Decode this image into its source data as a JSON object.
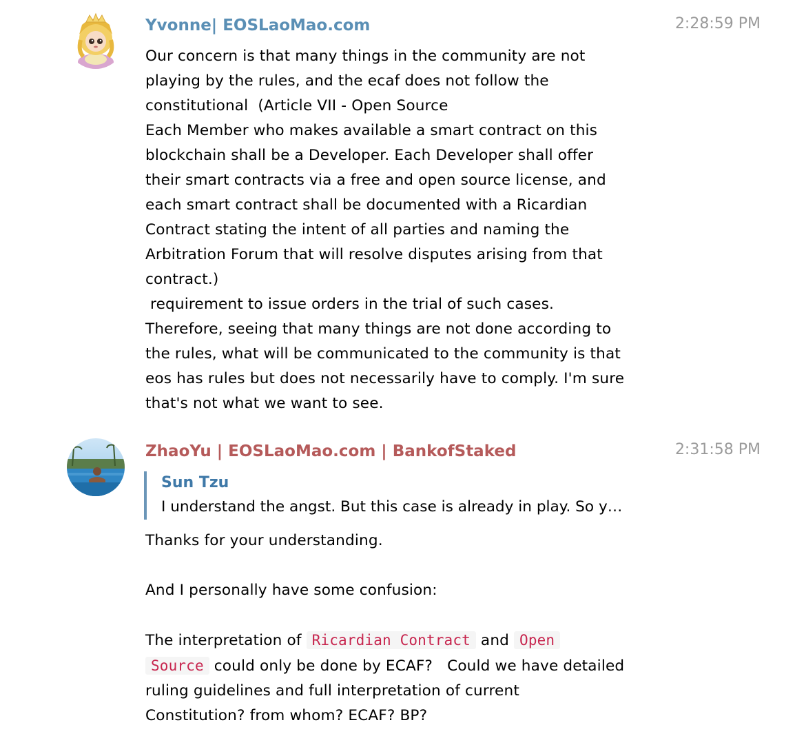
{
  "messages": [
    {
      "sender": "Yvonne| EOSLaoMao.com",
      "time": "2:28:59 PM",
      "color": "#5a8fb5",
      "lines": [
        "Our concern is that many things in the community are not",
        "playing by the rules, and the ecaf does not follow the",
        "constitutional  (Article VII - Open Source",
        "Each Member who makes available a smart contract on this",
        "blockchain shall be a Developer. Each Developer shall offer",
        "their smart contracts via a free and open source license, and",
        "each smart contract shall be documented with a Ricardian",
        "Contract stating the intent of all parties and naming the",
        "Arbitration Forum that will resolve disputes arising from that",
        "contract.)",
        " requirement to issue orders in the trial of such cases.",
        "Therefore, seeing that many things are not done according to",
        "the rules, what will be communicated to the community is that",
        "eos has rules but does not necessarily have to comply. I'm sure",
        "that's not what we want to see."
      ]
    },
    {
      "sender": "ZhaoYu | EOSLaoMao.com | BankofStaked",
      "time": "2:31:58 PM",
      "color": "#b55a5a",
      "reply": {
        "author": "Sun Tzu",
        "text": "I understand the angst. But this case is already in play. So y…"
      },
      "body": {
        "line1": "Thanks for your understanding.",
        "line2": "And I personally have some confusion:",
        "p3_a": "The interpretation of ",
        "p3_code1": "Ricardian Contract",
        "p3_b": " and ",
        "p3_code2a": "Open",
        "p3_code2b": "Source",
        "p3_c": " could only be done by ECAF?   Could we have detailed",
        "p3_d": "ruling guidelines and full interpretation of current",
        "p3_e": "Constitution? from whom? ECAF? BP?"
      }
    }
  ]
}
